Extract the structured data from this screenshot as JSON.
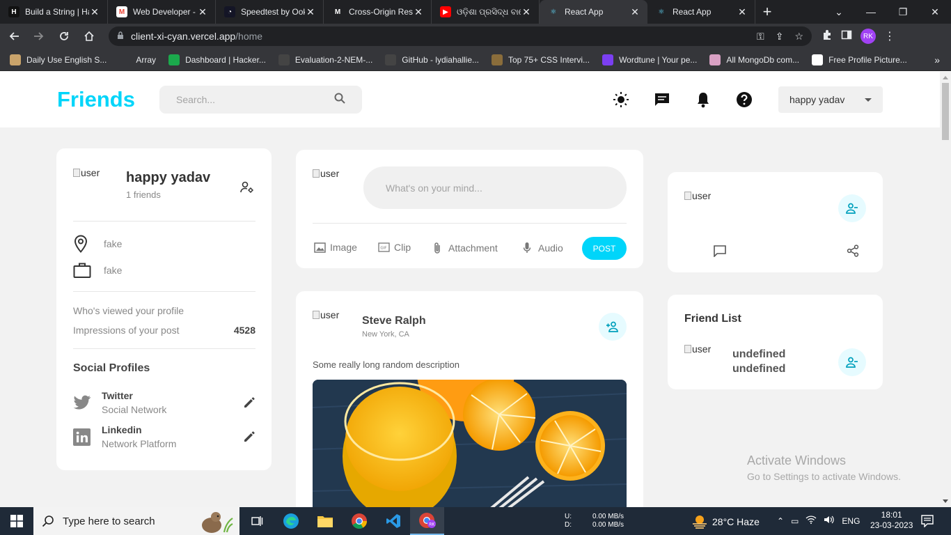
{
  "browser": {
    "tabs": [
      {
        "title": "Build a String | Ha",
        "fav_color": "#111111",
        "fav_text": "H"
      },
      {
        "title": "Web Developer -",
        "fav_color": "#ffffff",
        "fav_text": "M"
      },
      {
        "title": "Speedtest by Ook",
        "fav_color": "#141526",
        "fav_text": "◔"
      },
      {
        "title": "Cross-Origin Res",
        "fav_color": "#202124",
        "fav_text": "M"
      },
      {
        "title": "ଓଡ଼ିଶା ପ୍ରସିଦ୍ଧ ବାଲେ",
        "fav_color": "#ff0000",
        "fav_text": "▶"
      },
      {
        "title": "React App",
        "fav_color": "#35363a",
        "fav_text": "⚛"
      },
      {
        "title": "React App",
        "fav_color": "#202124",
        "fav_text": "⚛"
      }
    ],
    "url_host": "client-xi-cyan.vercel.app",
    "url_path": "/home",
    "profile_initials": "RK",
    "bookmarks": [
      {
        "label": "Daily Use English S...",
        "color": "#c9a36b"
      },
      {
        "label": "Array",
        "color": "#35363a"
      },
      {
        "label": "Dashboard | Hacker...",
        "color": "#1ba94c"
      },
      {
        "label": "Evaluation-2-NEM-...",
        "color": "#444444"
      },
      {
        "label": "GitHub - lydiahallie...",
        "color": "#444444"
      },
      {
        "label": "Top 75+ CSS Intervi...",
        "color": "#8a6d3b"
      },
      {
        "label": "Wordtune | Your pe...",
        "color": "#7b3ff2"
      },
      {
        "label": "All MongoDb com...",
        "color": "#d9a1c4"
      },
      {
        "label": "Free Profile Picture...",
        "color": "#ffffff"
      }
    ]
  },
  "app": {
    "logo": "Friends",
    "search_placeholder": "Search...",
    "user_select": "happy yadav",
    "accent": "#00d5fa"
  },
  "profile_card": {
    "avatar_alt": "user",
    "name": "happy yadav",
    "friends": "1 friends",
    "location": "fake",
    "occupation": "fake",
    "viewed_label": "Who's viewed your profile",
    "impressions_label": "Impressions of your post",
    "impressions_value": "4528",
    "social_title": "Social Profiles",
    "socials": [
      {
        "name": "Twitter",
        "desc": "Social Network"
      },
      {
        "name": "Linkedin",
        "desc": "Network Platform"
      }
    ]
  },
  "composer": {
    "avatar_alt": "user",
    "placeholder": "What's on your mind...",
    "tools": [
      "Image",
      "Clip",
      "Attachment",
      "Audio"
    ],
    "post_label": "POST"
  },
  "post": {
    "avatar_alt": "user",
    "author": "Steve Ralph",
    "location": "New York, CA",
    "description": "Some really long random description"
  },
  "ad_card": {
    "avatar_alt": "user"
  },
  "friend_list": {
    "title": "Friend List",
    "friends": [
      {
        "avatar_alt": "user",
        "name_line1": "undefined",
        "name_line2": "undefined"
      }
    ]
  },
  "watermark": {
    "line1": "Activate Windows",
    "line2": "Go to Settings to activate Windows."
  },
  "taskbar": {
    "search_placeholder": "Type here to search",
    "net_labels": [
      "U:",
      "D:"
    ],
    "net_values": [
      "0.00 MB/s",
      "0.00 MB/s"
    ],
    "weather": "28°C  Haze",
    "lang": "ENG",
    "time": "18:01",
    "date": "23-03-2023"
  }
}
